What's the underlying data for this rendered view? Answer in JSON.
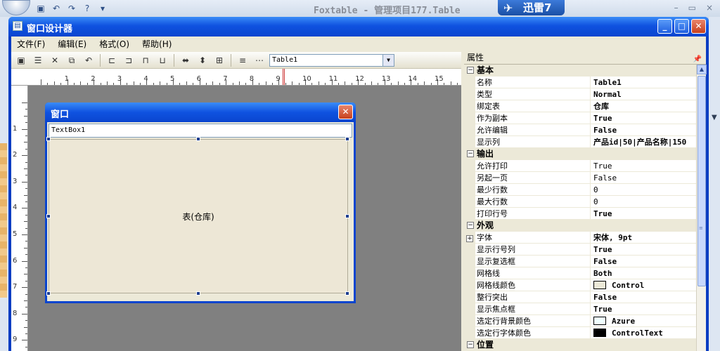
{
  "app": {
    "title": "Foxtable - 管理项目177.Table",
    "xunlei_label": "迅雷7",
    "quick_access": [
      "save-icon",
      "undo-icon",
      "redo-icon",
      "help-icon",
      "customize-icon"
    ]
  },
  "designer": {
    "title": "窗口设计器",
    "menu": [
      "文件(F)",
      "编辑(E)",
      "格式(O)",
      "帮助(H)"
    ],
    "toolbar_selected": "Table1"
  },
  "ruler": {
    "top_numbers": [
      "1",
      "2",
      "3",
      "4",
      "5",
      "6",
      "7",
      "8",
      "9",
      "10",
      "11",
      "12",
      "13",
      "14",
      "15"
    ],
    "left_numbers": [
      "1",
      "2",
      "3",
      "4",
      "5",
      "6",
      "7",
      "8",
      "9"
    ]
  },
  "form": {
    "title": "窗口",
    "textbox_text": "TextBox1",
    "table_label": "表(仓库)"
  },
  "props": {
    "header": "属性",
    "categories": [
      {
        "name": "基本",
        "rows": [
          {
            "name": "名称",
            "value": "Table1",
            "bold": true
          },
          {
            "name": "类型",
            "value": "Normal",
            "bold": true
          },
          {
            "name": "绑定表",
            "value": "仓库",
            "bold": true
          },
          {
            "name": "作为副本",
            "value": "True",
            "bold": true
          },
          {
            "name": "允许编辑",
            "value": "False",
            "bold": true
          },
          {
            "name": "显示列",
            "value": "产品id|50|产品名称|150",
            "bold": true
          }
        ]
      },
      {
        "name": "输出",
        "rows": [
          {
            "name": "允许打印",
            "value": "True",
            "bold": false
          },
          {
            "name": "另起一页",
            "value": "False",
            "bold": false
          },
          {
            "name": "最少行数",
            "value": "0",
            "bold": false
          },
          {
            "name": "最大行数",
            "value": "0",
            "bold": false
          },
          {
            "name": "打印行号",
            "value": "True",
            "bold": true
          }
        ]
      },
      {
        "name": "外观",
        "rows": [
          {
            "name": "字体",
            "value": "宋体, 9pt",
            "bold": true,
            "expandable": true
          },
          {
            "name": "显示行号列",
            "value": "True",
            "bold": true
          },
          {
            "name": "显示复选框",
            "value": "False",
            "bold": true
          },
          {
            "name": "网格线",
            "value": "Both",
            "bold": true
          },
          {
            "name": "网格线颜色",
            "value": "Control",
            "bold": true,
            "swatch": "#ece9d8"
          },
          {
            "name": "整行突出",
            "value": "False",
            "bold": true
          },
          {
            "name": "显示焦点框",
            "value": "True",
            "bold": true
          },
          {
            "name": "选定行背景颜色",
            "value": "Azure",
            "bold": true,
            "swatch": "#f0ffff"
          },
          {
            "name": "选定行字体颜色",
            "value": "ControlText",
            "bold": true,
            "swatch": "#000000"
          }
        ]
      },
      {
        "name": "位置",
        "rows": []
      }
    ]
  }
}
